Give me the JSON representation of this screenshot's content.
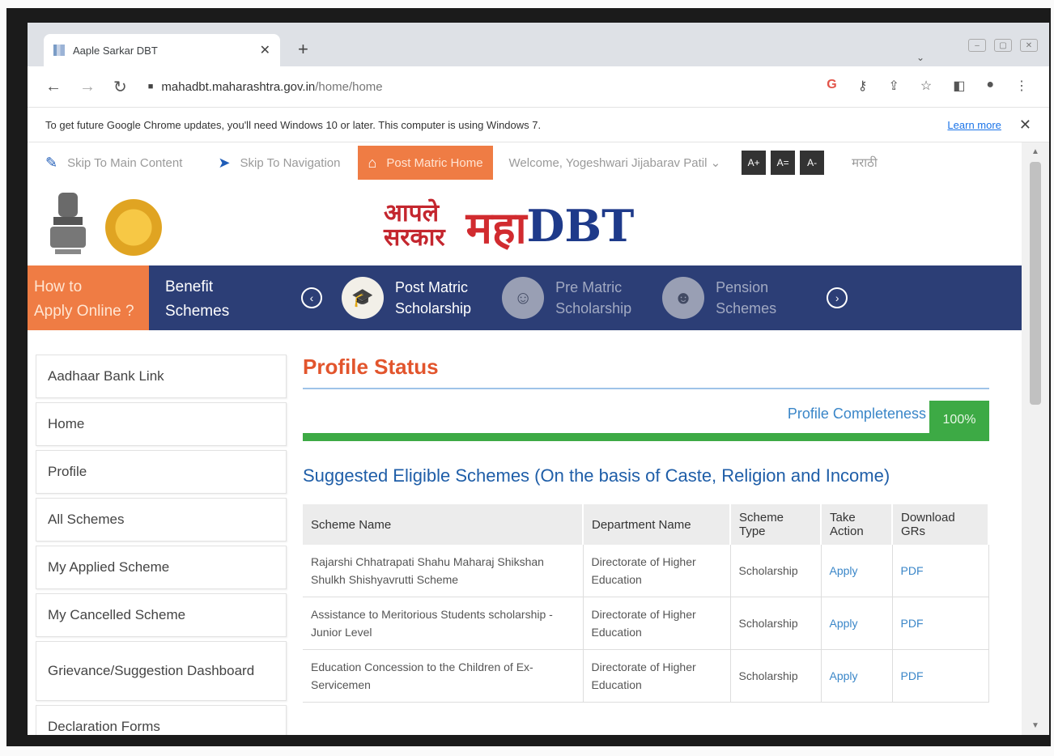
{
  "browser": {
    "tab_title": "Aaple Sarkar DBT",
    "new_tab": "+",
    "url_host": "mahadbt.maharashtra.gov.in",
    "url_path": "/home/home",
    "infobar_message": "To get future Google Chrome updates, you'll need Windows 10 or later. This computer is using Windows 7.",
    "infobar_link": "Learn more"
  },
  "utility": {
    "skip_main": "Skip To Main Content",
    "skip_nav": "Skip To Navigation",
    "post_matric_home": "Post Matric Home",
    "welcome": "Welcome, Yogeshwari Jijabarav Patil",
    "font_increase": "A+",
    "font_reset": "A=",
    "font_decrease": "A-",
    "language": "मराठी"
  },
  "brand": {
    "aaple_line1": "आपले",
    "aaple_line2": "सरकार",
    "maha": "महा",
    "dbt": "DBT"
  },
  "banner": {
    "how_to_line1": "How to",
    "how_to_line2": "Apply Online ?",
    "benefit_line1": "Benefit",
    "benefit_line2": "Schemes",
    "schemes": [
      {
        "line1": "Post Matric",
        "line2": "Scholarship"
      },
      {
        "line1": "Pre Matric",
        "line2": "Scholarship"
      },
      {
        "line1": "Pension",
        "line2": "Schemes"
      }
    ]
  },
  "sidebar": {
    "items": [
      {
        "label": "Aadhaar Bank Link"
      },
      {
        "label": "Home"
      },
      {
        "label": "Profile"
      },
      {
        "label": "All Schemes"
      },
      {
        "label": "My Applied Scheme"
      },
      {
        "label": "My Cancelled Scheme"
      },
      {
        "label": "Grievance/Suggestion Dashboard"
      },
      {
        "label": "Declaration Forms"
      }
    ]
  },
  "main": {
    "title": "Profile Status",
    "profile_completeness_label": "Profile Completeness",
    "profile_completeness_value": "100%",
    "profile_completeness_fraction": 1.0,
    "suggested_heading": "Suggested Eligible Schemes (On the basis of Caste, Religion and Income)",
    "table": {
      "headers": [
        "Scheme Name",
        "Department Name",
        "Scheme Type",
        "Take Action",
        "Download GRs"
      ],
      "rows": [
        {
          "scheme": "Rajarshi Chhatrapati Shahu Maharaj Shikshan Shulkh Shishyavrutti Scheme",
          "department": "Directorate of Higher Education",
          "type": "Scholarship",
          "action": "Apply",
          "download": "PDF"
        },
        {
          "scheme": "Assistance to Meritorious Students scholarship - Junior Level",
          "department": "Directorate of Higher Education",
          "type": "Scholarship",
          "action": "Apply",
          "download": "PDF"
        },
        {
          "scheme": "Education Concession to the Children of Ex-Servicemen",
          "department": "Directorate of Higher Education",
          "type": "Scholarship",
          "action": "Apply",
          "download": "PDF"
        }
      ]
    }
  },
  "colors": {
    "accent_orange": "#ef7c44",
    "banner_blue": "#2c3e76",
    "progress_green": "#3daa45",
    "link_blue": "#3a86c8",
    "title_orange": "#e2552d"
  }
}
